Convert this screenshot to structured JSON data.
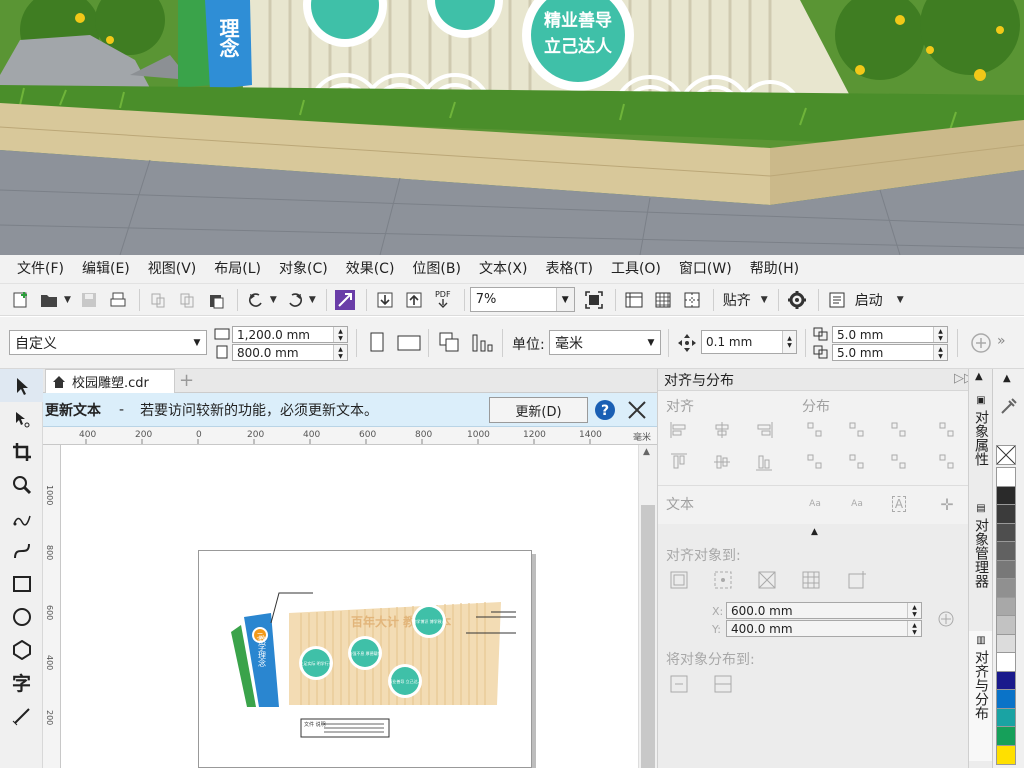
{
  "photo": {
    "sign_text_line1": "精业善导",
    "sign_text_line2": "立己达人",
    "pillar_text": "理念"
  },
  "menu": [
    "文件(F)",
    "编辑(E)",
    "视图(V)",
    "布局(L)",
    "对象(C)",
    "效果(C)",
    "位图(B)",
    "文本(X)",
    "表格(T)",
    "工具(O)",
    "窗口(W)",
    "帮助(H)"
  ],
  "toolbar1": {
    "zoom": "7%",
    "snap_label": "贴齐",
    "launch_label": "启动",
    "pdf_label": "PDF"
  },
  "toolbar2": {
    "page_preset": "自定义",
    "width": "1,200.0 mm",
    "height": "800.0 mm",
    "unit_label": "单位:",
    "unit_value": "毫米",
    "nudge": "0.1 mm",
    "dup_x": "5.0 mm",
    "dup_y": "5.0 mm"
  },
  "document": {
    "tab_title": "校园雕塑.cdr",
    "notify_title": "更新文本",
    "notify_dash": "-",
    "notify_message": "若要访问较新的功能，必须更新文本。",
    "update_button": "更新(D)",
    "ruler_top_labels": [
      "400",
      "200",
      "0",
      "200",
      "400",
      "600",
      "800",
      "1000",
      "1200",
      "1400"
    ],
    "ruler_unit": "毫米",
    "ruler_left_labels": [
      "1000",
      "800",
      "600",
      "400",
      "200"
    ]
  },
  "artwork": {
    "pillar_num": "二",
    "pillar_text": "教学理念",
    "headline": "百年大计 教育为本",
    "circle1": "立足实际 明学行致",
    "circle2": "自强不息 厚德载物",
    "circle3": "勤学博识 博学致远",
    "circle4": "精业善导 立己达人",
    "caption_label": "文件 说明"
  },
  "docker": {
    "title": "对齐与分布",
    "align_label": "对齐",
    "distribute_label": "分布",
    "text_label": "文本",
    "align_to_label": "对齐对象到:",
    "x_label": "X:",
    "x_value": "600.0 mm",
    "y_label": "Y:",
    "y_value": "400.0 mm",
    "distribute_to_label": "将对象分布到:"
  },
  "docker_tabs": [
    "对象属性",
    "对象管理器",
    "对齐与分布"
  ],
  "palette": [
    "#ffffff",
    "#2a2a2a",
    "#3b3b3b",
    "#4e4e4e",
    "#616161",
    "#787878",
    "#909090",
    "#a8a8a8",
    "#c2c2c2",
    "#dcdcdc",
    "#ffffff",
    "#1a1a8c",
    "#0a73c8",
    "#1aa3a3",
    "#16a05a",
    "#ffe000"
  ]
}
